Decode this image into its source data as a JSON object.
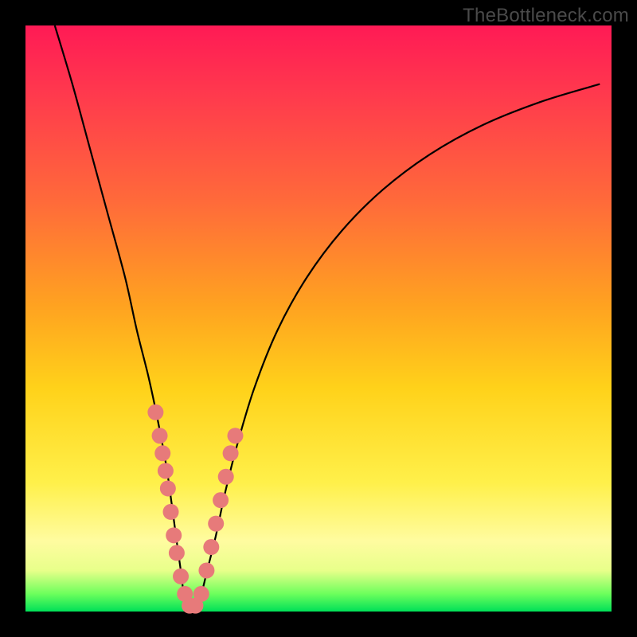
{
  "watermark": "TheBottleneck.com",
  "colors": {
    "curve": "#000000",
    "dot": "#e77a7a",
    "frame": "#000000"
  },
  "chart_data": {
    "type": "line",
    "title": "",
    "xlabel": "",
    "ylabel": "",
    "xlim": [
      0,
      100
    ],
    "ylim": [
      0,
      100
    ],
    "series": [
      {
        "name": "bottleneck-curve",
        "x": [
          5,
          8,
          11,
          14,
          17,
          19,
          21,
          22.5,
          24,
          25,
          25.8,
          26.5,
          27,
          27.5,
          28,
          29,
          30,
          31,
          32.5,
          34,
          36,
          39,
          43,
          48,
          54,
          61,
          69,
          78,
          88,
          98
        ],
        "y": [
          100,
          90,
          79,
          68,
          57,
          48,
          40,
          33,
          25,
          18,
          12,
          7,
          3,
          1,
          0.5,
          1,
          3,
          7,
          13,
          20,
          28,
          38,
          48,
          57,
          65,
          72,
          78,
          83,
          87,
          90
        ]
      }
    ],
    "markers": {
      "name": "sample-points",
      "x": [
        22.2,
        22.9,
        23.4,
        23.9,
        24.3,
        24.8,
        25.3,
        25.8,
        26.5,
        27.2,
        28.0,
        29.0,
        30.0,
        30.9,
        31.7,
        32.5,
        33.3,
        34.2,
        35.0,
        35.8
      ],
      "y": [
        34,
        30,
        27,
        24,
        21,
        17,
        13,
        10,
        6,
        3,
        1,
        1,
        3,
        7,
        11,
        15,
        19,
        23,
        27,
        30
      ]
    }
  }
}
